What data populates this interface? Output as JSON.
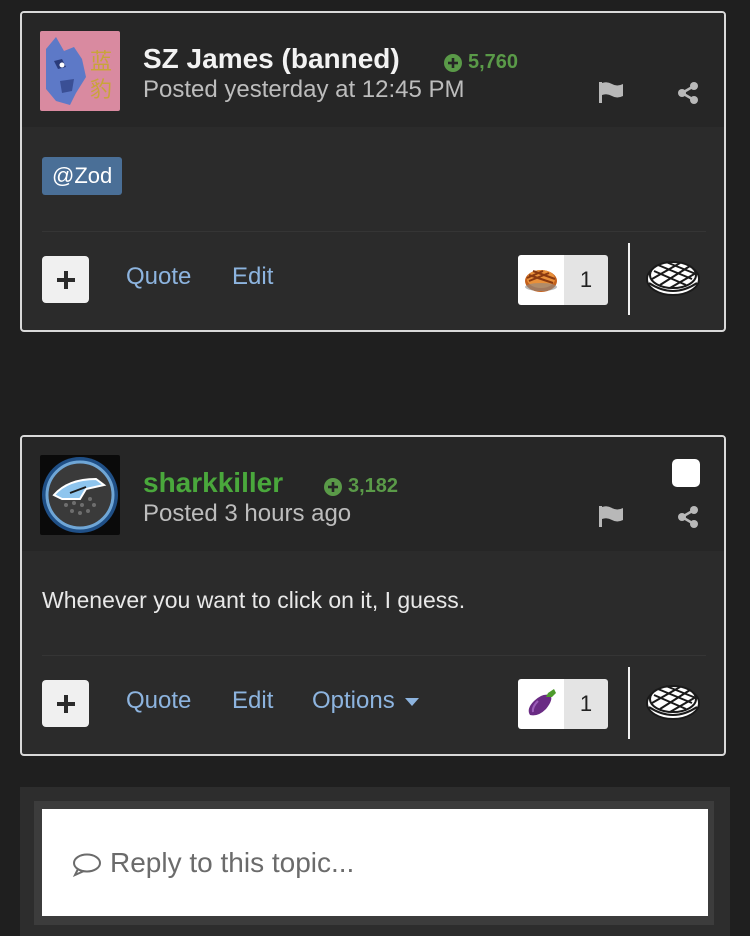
{
  "posts": [
    {
      "author": "SZ James (banned)",
      "reputation": "5,760",
      "posted": "Posted yesterday at 12:45 PM",
      "mention": "@Zod",
      "actions": {
        "quote": "Quote",
        "edit": "Edit"
      },
      "reaction": {
        "icon": "pie-emoji",
        "count": "1"
      }
    },
    {
      "author": "sharkkiller",
      "reputation": "3,182",
      "posted": "Posted 3 hours ago",
      "text": "Whenever you want to click on it, I guess.",
      "actions": {
        "quote": "Quote",
        "edit": "Edit",
        "options": "Options"
      },
      "reaction": {
        "icon": "eggplant-emoji",
        "count": "1"
      }
    }
  ],
  "reply": {
    "placeholder": "Reply to this topic..."
  },
  "colors": {
    "background": "#1f1f1f",
    "card": "#2b2b2b",
    "link": "#8db4df",
    "reputation": "#5a9a48",
    "username_green": "#4aa83c",
    "mention_bg": "#4a6f97"
  }
}
